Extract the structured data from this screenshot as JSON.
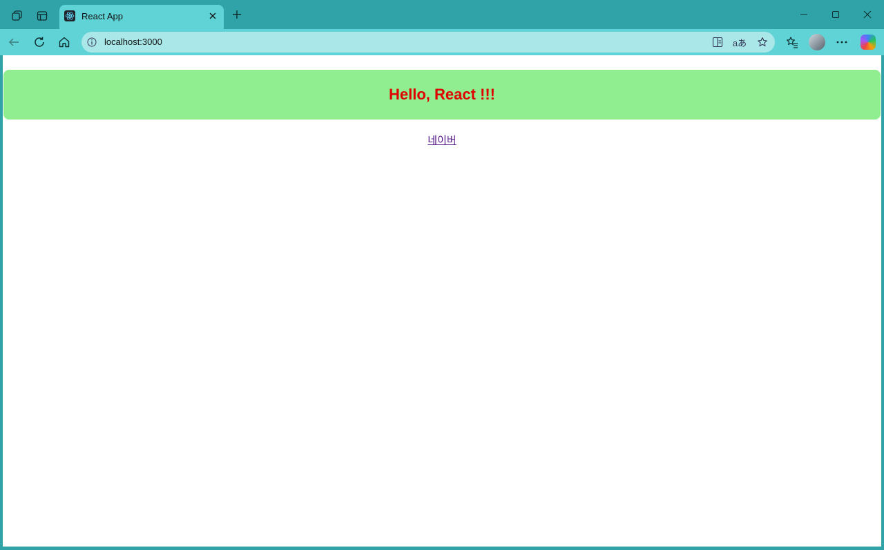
{
  "browser": {
    "tab_title": "React App",
    "url": "localhost:3000",
    "icons": {
      "workspaces": "workspaces-icon",
      "tab_actions": "tab-actions-icon",
      "favicon": "react-logo-icon",
      "close_tab": "close-icon",
      "new_tab": "plus-icon",
      "minimize": "minimize-icon",
      "maximize": "maximize-icon",
      "close_window": "close-icon",
      "back": "back-arrow-icon",
      "refresh": "refresh-icon",
      "home": "home-icon",
      "site_info": "info-icon",
      "immersive_reader": "immersive-reader-icon",
      "translate": "translate-icon",
      "favorite": "star-icon",
      "favorites": "favorites-icon",
      "profile": "avatar",
      "more": "more-icon",
      "copilot": "copilot-icon"
    },
    "translate_glyph": "aあ",
    "colors": {
      "frame": "#2fa3a7",
      "toolbar": "#5fd3d6",
      "omnibox": "#a9e7e8"
    }
  },
  "page": {
    "heading": "Hello, React !!!",
    "link_text": "네이버",
    "colors": {
      "heading_bg": "#90ee90",
      "heading_text": "#e00000",
      "link": "#551a8b"
    }
  }
}
